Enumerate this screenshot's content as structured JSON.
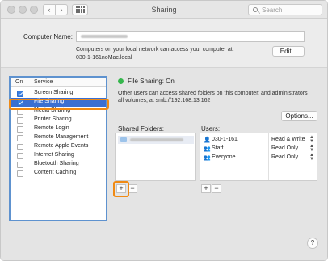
{
  "window": {
    "title": "Sharing"
  },
  "toolbar": {
    "back_glyph": "‹",
    "forward_glyph": "›",
    "search_placeholder": "Search"
  },
  "computer_name": {
    "label": "Computer Name:",
    "description_line1": "Computers on your local network can access your computer at:",
    "description_line2": "030-1-161noMac.local",
    "edit_label": "Edit..."
  },
  "services": {
    "header_on": "On",
    "header_service": "Service",
    "items": [
      {
        "label": "Screen Sharing",
        "checked": true,
        "selected": false
      },
      {
        "label": "File Sharing",
        "checked": true,
        "selected": true
      },
      {
        "label": "Media Sharing",
        "checked": false,
        "selected": false
      },
      {
        "label": "Printer Sharing",
        "checked": false,
        "selected": false
      },
      {
        "label": "Remote Login",
        "checked": false,
        "selected": false
      },
      {
        "label": "Remote Management",
        "checked": false,
        "selected": false
      },
      {
        "label": "Remote Apple Events",
        "checked": false,
        "selected": false
      },
      {
        "label": "Internet Sharing",
        "checked": false,
        "selected": false
      },
      {
        "label": "Bluetooth Sharing",
        "checked": false,
        "selected": false
      },
      {
        "label": "Content Caching",
        "checked": false,
        "selected": false
      }
    ]
  },
  "file_sharing": {
    "status": "File Sharing: On",
    "status_color": "#35b64c",
    "description_line1": "Other users can access shared folders on this computer, and administrators",
    "description_line2": "all volumes, at smb://192.168.13.162",
    "options_label": "Options..."
  },
  "shared_folders": {
    "label": "Shared Folders:",
    "add_label": "+",
    "remove_label": "−"
  },
  "users": {
    "label": "Users:",
    "rows": [
      {
        "name": "030-1-161",
        "permission": "Read & Write",
        "icon": "user-icon"
      },
      {
        "name": "Staff",
        "permission": "Read Only",
        "icon": "group-icon"
      },
      {
        "name": "Everyone",
        "permission": "Read Only",
        "icon": "group-icon"
      }
    ],
    "add_label": "+",
    "remove_label": "−"
  },
  "help_label": "?",
  "accent_color": "#3b6fd1",
  "highlight_color": "#f08a14"
}
